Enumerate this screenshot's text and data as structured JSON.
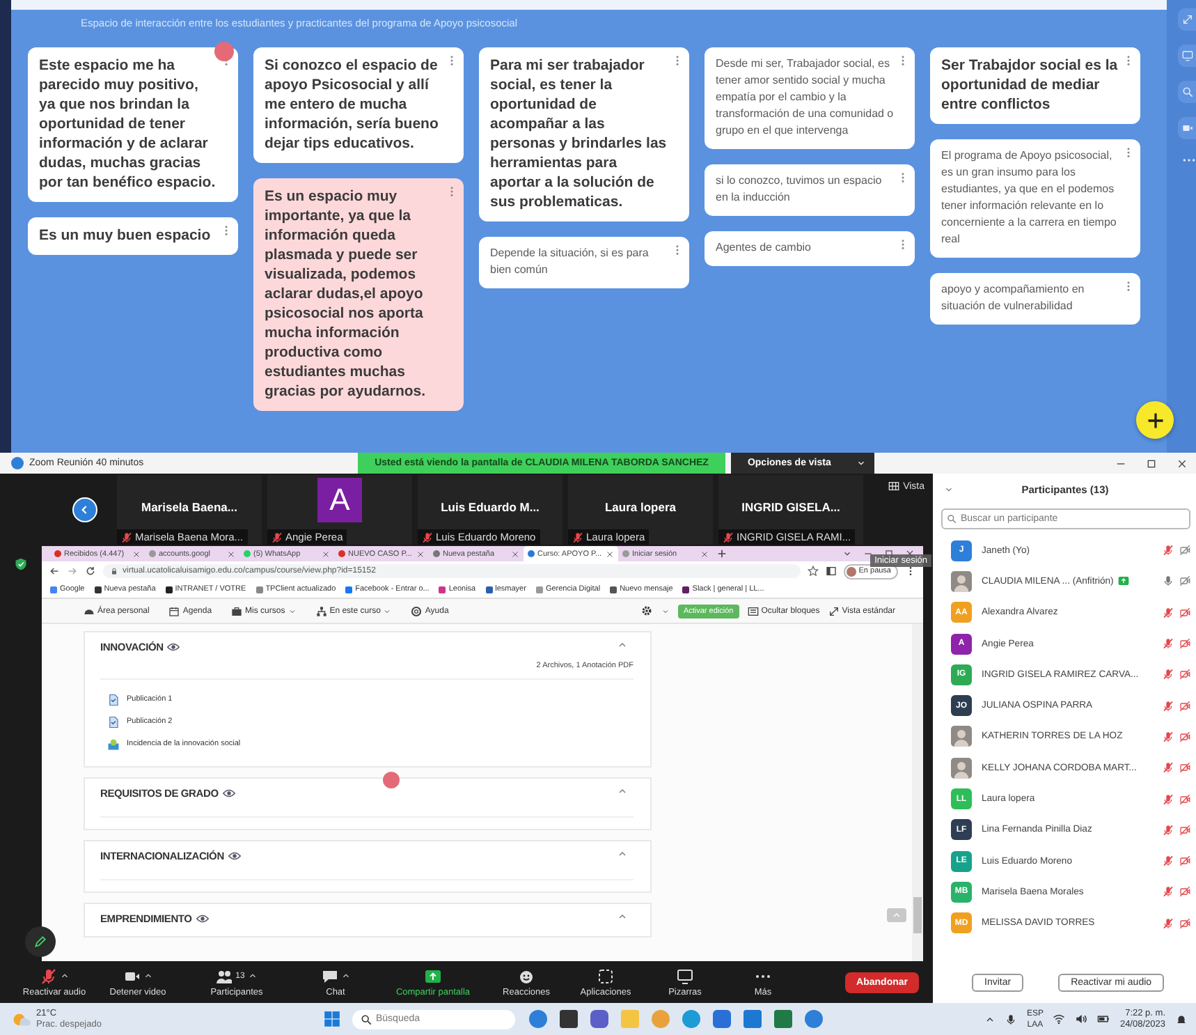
{
  "board": {
    "subtitle": "Espacio de interacción entre los estudiantes y practicantes del programa de Apoyo psicosocial",
    "columns": [
      {
        "cards": [
          {
            "kind": "bold",
            "color": "#ffffff",
            "text": "Este espacio me ha parecido muy positivo, ya que nos brindan la oportunidad de tener información y de aclarar dudas, muchas gracias por tan benéfico espacio."
          },
          {
            "kind": "bold",
            "color": "#ffffff",
            "text": "Es un muy buen espacio"
          }
        ]
      },
      {
        "cards": [
          {
            "kind": "bold",
            "color": "#ffffff",
            "text": "Si conozco el espacio de apoyo Psicosocial y allí me entero de mucha información, sería bueno dejar tips educativos."
          },
          {
            "kind": "bold",
            "color": "#fdd8da",
            "text": "Es un espacio muy importante, ya que la información queda plasmada y puede ser visualizada, podemos aclarar dudas,el apoyo psicosocial nos aporta mucha información productiva como estudiantes muchas gracias por ayudarnos."
          }
        ]
      },
      {
        "cards": [
          {
            "kind": "bold",
            "color": "#ffffff",
            "text": "Para mi ser trabajador social, es tener la oportunidad de acompañar a las personas y brindarles las herramientas para aportar a la solución de sus problematicas."
          },
          {
            "kind": "plain",
            "color": "#ffffff",
            "text": "Depende la situación, si es para bien común"
          }
        ]
      },
      {
        "cards": [
          {
            "kind": "plain",
            "color": "#ffffff",
            "text": "Desde mi ser, Trabajador social, es tener amor sentido social y mucha empatía por el cambio y la transformación de una comunidad o grupo en el que intervenga"
          },
          {
            "kind": "plain",
            "color": "#ffffff",
            "text": "si lo conozco, tuvimos un espacio en la inducción"
          },
          {
            "kind": "plain",
            "color": "#ffffff",
            "text": "Agentes de cambio"
          }
        ]
      },
      {
        "cards": [
          {
            "kind": "bold",
            "color": "#ffffff",
            "text": "Ser Trabajdor social es la oportunidad de mediar entre conflictos"
          },
          {
            "kind": "plain",
            "color": "#ffffff",
            "text": "El programa de Apoyo psicosocial, es un gran insumo para los estudiantes, ya que en el podemos tener información relevante en lo concerniente a la carrera en tiempo real"
          },
          {
            "kind": "plain",
            "color": "#ffffff",
            "text": "apoyo y acompañamiento en situación de vulnerabilidad"
          }
        ]
      }
    ]
  },
  "zoom": {
    "title": "Zoom Reunión 40 minutos",
    "banner": "Usted está viendo la pantalla de CLAUDIA MILENA TABORDA SANCHEZ",
    "view_options": "Opciones de vista",
    "view_button": "Vista",
    "tiles": [
      {
        "kind": "name",
        "name": "Marisela Baena...",
        "label": "Marisela Baena Mora..."
      },
      {
        "kind": "avatar",
        "initial": "A",
        "label": "Angie Perea"
      },
      {
        "kind": "name",
        "name": "Luis Eduardo M...",
        "label": "Luis Eduardo Moreno"
      },
      {
        "kind": "name",
        "name": "Laura lopera",
        "label": "Laura lopera"
      },
      {
        "kind": "name",
        "name": "INGRID GISELA...",
        "label": "INGRID GISELA RAMI..."
      }
    ]
  },
  "browser": {
    "tabs": [
      {
        "label": "Recibidos (4.447)",
        "selected": false
      },
      {
        "label": "accounts.googl",
        "selected": false
      },
      {
        "label": "(5) WhatsApp",
        "selected": false
      },
      {
        "label": "NUEVO CASO P...",
        "selected": false
      },
      {
        "label": "Nueva pestaña",
        "selected": false
      },
      {
        "label": "Curso: APOYO P...",
        "selected": true
      },
      {
        "label": "Iniciar sesión",
        "selected": false
      }
    ],
    "url": "virtual.ucatolicaluisamigo.edu.co/campus/course/view.php?id=15152",
    "profile": "En pausa",
    "tooltip": "Iniciar sesión",
    "bookmarks": [
      "Google",
      "Nueva pestaña",
      "INTRANET / VOTRE",
      "TPClient actualizado",
      "Facebook - Entrar o...",
      "Leonisa",
      "lesmayer",
      "Gerencia Digital",
      "Nuevo mensaje",
      "Slack | general | LL..."
    ]
  },
  "moodle": {
    "nav": [
      {
        "label": "Área personal",
        "dropdown": false
      },
      {
        "label": "Agenda",
        "dropdown": false
      },
      {
        "label": "Mis cursos",
        "dropdown": true
      },
      {
        "label": "En este curso",
        "dropdown": true
      },
      {
        "label": "Ayuda",
        "dropdown": false
      }
    ],
    "edit_button": "Activar edición",
    "hide_blocks": "Ocultar bloques",
    "standard_view": "Vista estándar",
    "sections": [
      {
        "title": "INNOVACIÓN",
        "summary": "2 Archivos, 1 Anotación PDF",
        "items": [
          {
            "label": "Publicación 1",
            "kind": "file"
          },
          {
            "label": "Publicación 2",
            "kind": "file"
          },
          {
            "label": "Incidencia de la innovación social",
            "kind": "resource"
          }
        ]
      },
      {
        "title": "REQUISITOS DE GRADO"
      },
      {
        "title": "INTERNACIONALIZACIÓN"
      },
      {
        "title": "EMPRENDIMIENTO"
      }
    ]
  },
  "toolbar": {
    "items": [
      {
        "label": "Reactivar audio",
        "kind": "audio",
        "caret": true
      },
      {
        "label": "Detener video",
        "kind": "video",
        "caret": true
      },
      {
        "label": "Participantes",
        "kind": "participants",
        "caret": true,
        "count": "13"
      },
      {
        "label": "Chat",
        "kind": "chat",
        "caret": true
      },
      {
        "label": "Compartir pantalla",
        "kind": "share",
        "caret": false
      },
      {
        "label": "Reacciones",
        "kind": "reactions",
        "caret": false
      },
      {
        "label": "Aplicaciones",
        "kind": "apps",
        "caret": false
      },
      {
        "label": "Pizarras",
        "kind": "whiteboard",
        "caret": false
      },
      {
        "label": "Más",
        "kind": "more",
        "caret": false
      }
    ],
    "leave": "Abandonar"
  },
  "participants": {
    "title": "Participantes (13)",
    "search_placeholder": "Buscar un participante",
    "people": [
      {
        "name": "Janeth (Yo)",
        "kind": "initials",
        "avatar": "J",
        "color": "#2d7fd8",
        "mic_muted": true,
        "video_on": true,
        "sharing": false
      },
      {
        "name": "CLAUDIA MILENA ... (Anfitrión)",
        "kind": "photo",
        "mic_muted": false,
        "video_on": true,
        "sharing": true
      },
      {
        "name": "Alexandra Alvarez",
        "kind": "initials",
        "avatar": "AA",
        "color": "#f0a020",
        "mic_muted": true,
        "video_on": false,
        "sharing": false
      },
      {
        "name": "Angie Perea",
        "kind": "initials",
        "avatar": "A",
        "color": "#8e24aa",
        "mic_muted": true,
        "video_on": false,
        "sharing": false
      },
      {
        "name": "INGRID GISELA RAMIREZ CARVA...",
        "kind": "initials",
        "avatar": "IG",
        "color": "#2eaa55",
        "mic_muted": true,
        "video_on": false,
        "sharing": false
      },
      {
        "name": "JULIANA OSPINA PARRA",
        "kind": "initials",
        "avatar": "JO",
        "color": "#2c3e50",
        "mic_muted": true,
        "video_on": false,
        "sharing": false
      },
      {
        "name": "KATHERIN TORRES DE LA HOZ",
        "kind": "photo",
        "mic_muted": true,
        "video_on": false,
        "sharing": false
      },
      {
        "name": "KELLY JOHANA CORDOBA MART...",
        "kind": "photo",
        "mic_muted": true,
        "video_on": false,
        "sharing": false
      },
      {
        "name": "Laura lopera",
        "kind": "initials",
        "avatar": "LL",
        "color": "#2ebd59",
        "mic_muted": true,
        "video_on": false,
        "sharing": false
      },
      {
        "name": "Lina Fernanda Pinilla Diaz",
        "kind": "initials",
        "avatar": "LF",
        "color": "#2f3e55",
        "mic_muted": true,
        "video_on": false,
        "sharing": false
      },
      {
        "name": "Luis Eduardo Moreno",
        "kind": "initials",
        "avatar": "LE",
        "color": "#17a38b",
        "mic_muted": true,
        "video_on": false,
        "sharing": false
      },
      {
        "name": "Marisela Baena Morales",
        "kind": "initials",
        "avatar": "MB",
        "color": "#29b36a",
        "mic_muted": true,
        "video_on": false,
        "sharing": false
      },
      {
        "name": "MELISSA DAVID TORRES",
        "kind": "initials",
        "avatar": "MD",
        "color": "#f0a020",
        "mic_muted": true,
        "video_on": false,
        "sharing": false
      }
    ],
    "buttons": [
      "Invitar",
      "Reactivar mi audio"
    ]
  },
  "taskbar": {
    "temperature": "21°C",
    "weather": "Prac. despejado",
    "search_placeholder": "Búsqueda",
    "language": "ESP",
    "layout": "LAA",
    "time": "7:22 p. m.",
    "date": "24/08/2023"
  }
}
